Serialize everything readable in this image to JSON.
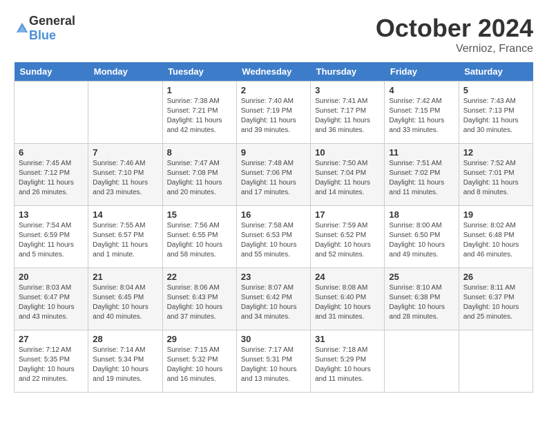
{
  "header": {
    "logo": {
      "general": "General",
      "blue": "Blue"
    },
    "title": "October 2024",
    "location": "Vernioz, France"
  },
  "weekdays": [
    "Sunday",
    "Monday",
    "Tuesday",
    "Wednesday",
    "Thursday",
    "Friday",
    "Saturday"
  ],
  "weeks": [
    [
      {
        "day": "",
        "info": ""
      },
      {
        "day": "",
        "info": ""
      },
      {
        "day": "1",
        "sunrise": "Sunrise: 7:38 AM",
        "sunset": "Sunset: 7:21 PM",
        "daylight": "Daylight: 11 hours and 42 minutes."
      },
      {
        "day": "2",
        "sunrise": "Sunrise: 7:40 AM",
        "sunset": "Sunset: 7:19 PM",
        "daylight": "Daylight: 11 hours and 39 minutes."
      },
      {
        "day": "3",
        "sunrise": "Sunrise: 7:41 AM",
        "sunset": "Sunset: 7:17 PM",
        "daylight": "Daylight: 11 hours and 36 minutes."
      },
      {
        "day": "4",
        "sunrise": "Sunrise: 7:42 AM",
        "sunset": "Sunset: 7:15 PM",
        "daylight": "Daylight: 11 hours and 33 minutes."
      },
      {
        "day": "5",
        "sunrise": "Sunrise: 7:43 AM",
        "sunset": "Sunset: 7:13 PM",
        "daylight": "Daylight: 11 hours and 30 minutes."
      }
    ],
    [
      {
        "day": "6",
        "sunrise": "Sunrise: 7:45 AM",
        "sunset": "Sunset: 7:12 PM",
        "daylight": "Daylight: 11 hours and 26 minutes."
      },
      {
        "day": "7",
        "sunrise": "Sunrise: 7:46 AM",
        "sunset": "Sunset: 7:10 PM",
        "daylight": "Daylight: 11 hours and 23 minutes."
      },
      {
        "day": "8",
        "sunrise": "Sunrise: 7:47 AM",
        "sunset": "Sunset: 7:08 PM",
        "daylight": "Daylight: 11 hours and 20 minutes."
      },
      {
        "day": "9",
        "sunrise": "Sunrise: 7:48 AM",
        "sunset": "Sunset: 7:06 PM",
        "daylight": "Daylight: 11 hours and 17 minutes."
      },
      {
        "day": "10",
        "sunrise": "Sunrise: 7:50 AM",
        "sunset": "Sunset: 7:04 PM",
        "daylight": "Daylight: 11 hours and 14 minutes."
      },
      {
        "day": "11",
        "sunrise": "Sunrise: 7:51 AM",
        "sunset": "Sunset: 7:02 PM",
        "daylight": "Daylight: 11 hours and 11 minutes."
      },
      {
        "day": "12",
        "sunrise": "Sunrise: 7:52 AM",
        "sunset": "Sunset: 7:01 PM",
        "daylight": "Daylight: 11 hours and 8 minutes."
      }
    ],
    [
      {
        "day": "13",
        "sunrise": "Sunrise: 7:54 AM",
        "sunset": "Sunset: 6:59 PM",
        "daylight": "Daylight: 11 hours and 5 minutes."
      },
      {
        "day": "14",
        "sunrise": "Sunrise: 7:55 AM",
        "sunset": "Sunset: 6:57 PM",
        "daylight": "Daylight: 11 hours and 1 minute."
      },
      {
        "day": "15",
        "sunrise": "Sunrise: 7:56 AM",
        "sunset": "Sunset: 6:55 PM",
        "daylight": "Daylight: 10 hours and 58 minutes."
      },
      {
        "day": "16",
        "sunrise": "Sunrise: 7:58 AM",
        "sunset": "Sunset: 6:53 PM",
        "daylight": "Daylight: 10 hours and 55 minutes."
      },
      {
        "day": "17",
        "sunrise": "Sunrise: 7:59 AM",
        "sunset": "Sunset: 6:52 PM",
        "daylight": "Daylight: 10 hours and 52 minutes."
      },
      {
        "day": "18",
        "sunrise": "Sunrise: 8:00 AM",
        "sunset": "Sunset: 6:50 PM",
        "daylight": "Daylight: 10 hours and 49 minutes."
      },
      {
        "day": "19",
        "sunrise": "Sunrise: 8:02 AM",
        "sunset": "Sunset: 6:48 PM",
        "daylight": "Daylight: 10 hours and 46 minutes."
      }
    ],
    [
      {
        "day": "20",
        "sunrise": "Sunrise: 8:03 AM",
        "sunset": "Sunset: 6:47 PM",
        "daylight": "Daylight: 10 hours and 43 minutes."
      },
      {
        "day": "21",
        "sunrise": "Sunrise: 8:04 AM",
        "sunset": "Sunset: 6:45 PM",
        "daylight": "Daylight: 10 hours and 40 minutes."
      },
      {
        "day": "22",
        "sunrise": "Sunrise: 8:06 AM",
        "sunset": "Sunset: 6:43 PM",
        "daylight": "Daylight: 10 hours and 37 minutes."
      },
      {
        "day": "23",
        "sunrise": "Sunrise: 8:07 AM",
        "sunset": "Sunset: 6:42 PM",
        "daylight": "Daylight: 10 hours and 34 minutes."
      },
      {
        "day": "24",
        "sunrise": "Sunrise: 8:08 AM",
        "sunset": "Sunset: 6:40 PM",
        "daylight": "Daylight: 10 hours and 31 minutes."
      },
      {
        "day": "25",
        "sunrise": "Sunrise: 8:10 AM",
        "sunset": "Sunset: 6:38 PM",
        "daylight": "Daylight: 10 hours and 28 minutes."
      },
      {
        "day": "26",
        "sunrise": "Sunrise: 8:11 AM",
        "sunset": "Sunset: 6:37 PM",
        "daylight": "Daylight: 10 hours and 25 minutes."
      }
    ],
    [
      {
        "day": "27",
        "sunrise": "Sunrise: 7:12 AM",
        "sunset": "Sunset: 5:35 PM",
        "daylight": "Daylight: 10 hours and 22 minutes."
      },
      {
        "day": "28",
        "sunrise": "Sunrise: 7:14 AM",
        "sunset": "Sunset: 5:34 PM",
        "daylight": "Daylight: 10 hours and 19 minutes."
      },
      {
        "day": "29",
        "sunrise": "Sunrise: 7:15 AM",
        "sunset": "Sunset: 5:32 PM",
        "daylight": "Daylight: 10 hours and 16 minutes."
      },
      {
        "day": "30",
        "sunrise": "Sunrise: 7:17 AM",
        "sunset": "Sunset: 5:31 PM",
        "daylight": "Daylight: 10 hours and 13 minutes."
      },
      {
        "day": "31",
        "sunrise": "Sunrise: 7:18 AM",
        "sunset": "Sunset: 5:29 PM",
        "daylight": "Daylight: 10 hours and 11 minutes."
      },
      {
        "day": "",
        "info": ""
      },
      {
        "day": "",
        "info": ""
      }
    ]
  ]
}
